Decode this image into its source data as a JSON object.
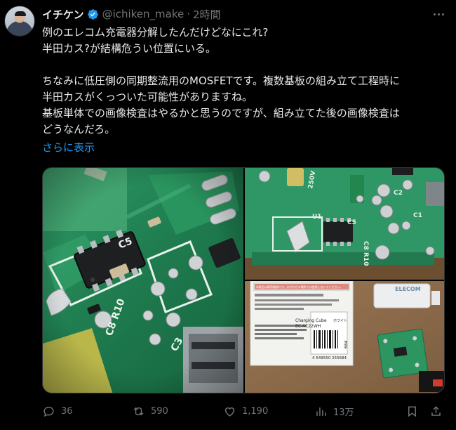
{
  "author": {
    "display_name": "イチケン",
    "handle": "@ichiken_make",
    "separator": "·",
    "time": "2時間"
  },
  "tweet": {
    "lines": [
      "例のエレコム充電器分解したんだけどなにこれ?",
      "半田カス?が結構危うい位置にいる。",
      "",
      "ちなみに低圧側の同期整流用のMOSFETです。複数基板の組み立て工程時に",
      "半田カスがくっついた可能性がありますね。",
      "基板単体での画像検査はやるかと思うのですが、組み立てた後の画像検査は",
      "どうなんだろ。"
    ],
    "show_more": "さらに表示"
  },
  "pcb_labels": {
    "c5": "C5",
    "c8_r10": "C8 R10",
    "u1": "U1",
    "c3": "C3",
    "c1": "C1",
    "c2": "C2",
    "v250": "250V"
  },
  "package_label": {
    "product_line1": "Charging Cube",
    "product_line2": "EC-AC22WH",
    "color": "ホワイト",
    "barcode_number": "4 549550 255684",
    "side_code": "684",
    "brand": "ELECOM",
    "warning": "本製品は精密機器です。水がかかる場所では使用しないでください。"
  },
  "actions": {
    "replies": "36",
    "reposts": "590",
    "likes": "1,190",
    "views": "13万"
  },
  "colors": {
    "background": "#000000",
    "text": "#e7e9ea",
    "secondary": "#71767b",
    "accent": "#1d9bf0",
    "pcb_green": "#1f7d50"
  }
}
